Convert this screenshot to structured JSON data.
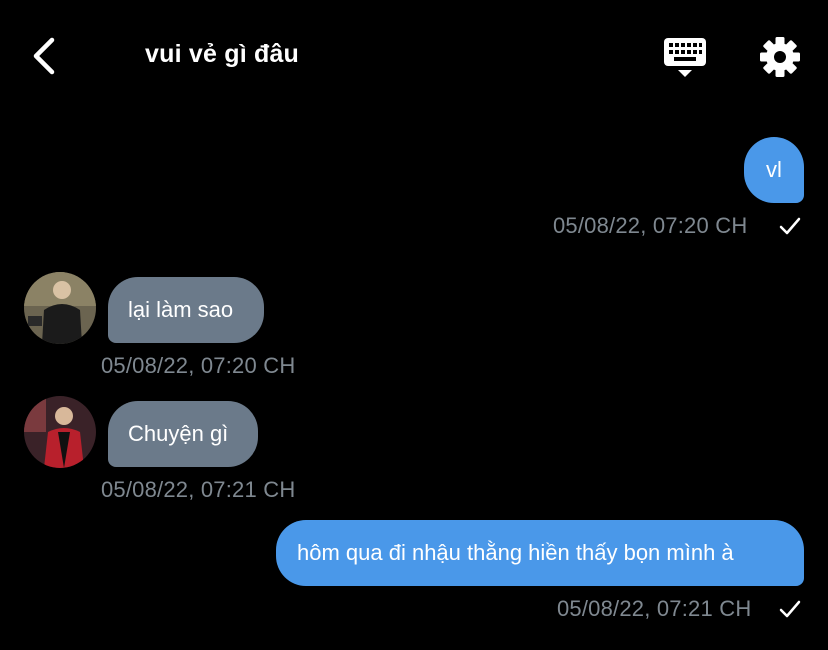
{
  "header": {
    "title": "vui vẻ gì đâu",
    "back_icon": "chevron-left-icon",
    "keyboard_icon": "keyboard-icon",
    "settings_icon": "gear-icon"
  },
  "messages": [
    {
      "direction": "outgoing",
      "text": "vl",
      "timestamp": "05/08/22, 07:20 CH",
      "read_icon": "checkmark-icon"
    },
    {
      "direction": "incoming",
      "text": "lại làm sao",
      "timestamp": "05/08/22, 07:20 CH",
      "avatar": "avatar"
    },
    {
      "direction": "incoming",
      "text": "Chuyện gì",
      "timestamp": "05/08/22, 07:21 CH",
      "avatar": "avatar"
    },
    {
      "direction": "outgoing",
      "text": "hôm qua đi nhậu thằng hiền thấy bọn mình à",
      "timestamp": "05/08/22, 07:21 CH",
      "read_icon": "checkmark-icon"
    }
  ],
  "colors": {
    "background": "#000000",
    "outgoing_bubble": "#4a98e9",
    "incoming_bubble": "#6b7a8a",
    "timestamp": "#7f8890"
  }
}
